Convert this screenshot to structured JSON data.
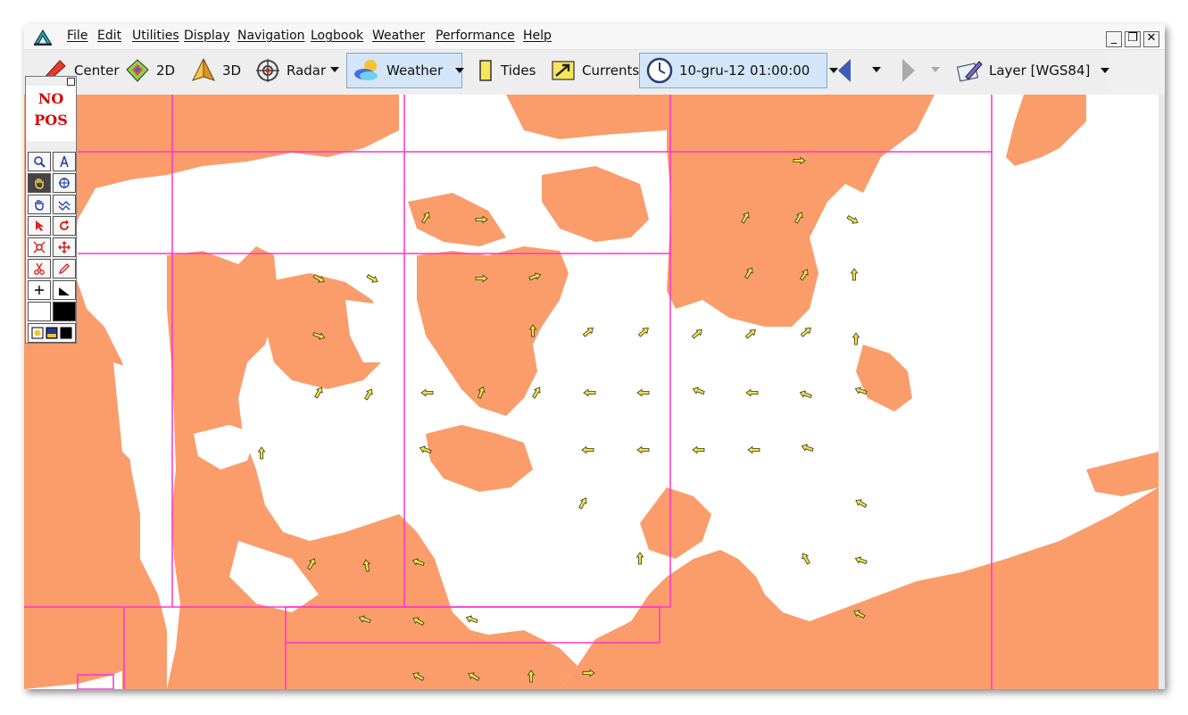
{
  "menu": [
    "File",
    "Edit",
    "Utilities",
    "Display",
    "Navigation",
    "Logbook",
    "Weather",
    "Performance",
    "Help"
  ],
  "window_controls": {
    "minimize": "_",
    "restore": "❐",
    "close": "✕"
  },
  "toolbar": {
    "center": "Center",
    "view2d": "2D",
    "view3d": "3D",
    "radar": "Radar",
    "weather": "Weather",
    "tides": "Tides",
    "currents": "Currents",
    "datetime": "10-gru-12 01:00:00",
    "layer": "Layer [WGS84]"
  },
  "palette": {
    "status_line1": "NO",
    "status_line2": "POS"
  },
  "colors": {
    "land": "#fa9d6b",
    "sea": "#ffffff",
    "grid": "#ff33cc",
    "arrow": "#f5e63a"
  }
}
